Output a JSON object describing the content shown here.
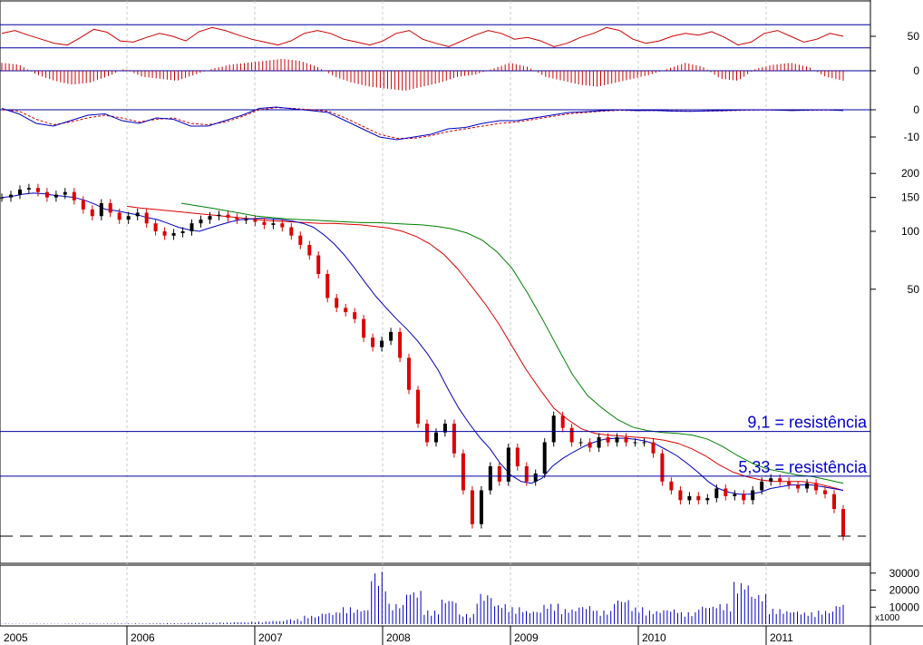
{
  "chart_data": {
    "type": "line",
    "scale": "log",
    "years": [
      "2005",
      "2006",
      "2007",
      "2008",
      "2009",
      "2010",
      "2011"
    ],
    "volume_unit": "x1000",
    "annotations": [
      {
        "text": "9,1 = resistência",
        "y": 9.1
      },
      {
        "text": "5,33 = resistência",
        "y": 5.33
      },
      {
        "text": "",
        "y": 2.6
      }
    ],
    "price_axis_ticks": [
      200,
      150,
      100,
      50
    ],
    "volume_axis_ticks": [
      30000,
      20000,
      10000
    ],
    "indicator1": {
      "ticks": [
        50
      ],
      "ref_lines": [
        70,
        30
      ],
      "ylim": [
        0,
        100
      ],
      "values": [
        55,
        60,
        52,
        45,
        38,
        35,
        48,
        62,
        57,
        42,
        40,
        48,
        55,
        50,
        42,
        58,
        65,
        60,
        52,
        45,
        40,
        35,
        42,
        55,
        60,
        55,
        45,
        40,
        35,
        42,
        55,
        60,
        45,
        38,
        32,
        42,
        52,
        60,
        55,
        45,
        48,
        42,
        32,
        38,
        48,
        55,
        65,
        60,
        45,
        38,
        42,
        50,
        55,
        52,
        58,
        48,
        35,
        40,
        55,
        60,
        50,
        40,
        45,
        55,
        50
      ]
    },
    "indicator2": {
      "ticks": [
        0
      ],
      "ylim": [
        -1,
        1
      ],
      "values": [
        0.4,
        0.3,
        -0.2,
        -0.5,
        -0.7,
        -0.6,
        -0.3,
        0.1,
        -0.3,
        -0.4,
        -0.5,
        -0.2,
        0.1,
        0.3,
        0.4,
        0.5,
        0.6,
        0.5,
        0.2,
        -0.3,
        -0.6,
        -0.8,
        -0.9,
        -1.0,
        -0.8,
        -0.6,
        -0.3,
        -0.2,
        0.1,
        0.4,
        0.2,
        -0.3,
        -0.5,
        -0.7,
        -0.8,
        -0.6,
        -0.4,
        -0.2,
        0.1,
        0.4,
        0.2,
        -0.4,
        -0.5,
        0.1,
        0.3,
        0.4,
        0.2,
        -0.3,
        -0.5
      ]
    },
    "indicator3": {
      "ticks": [
        0,
        -10
      ],
      "ylim": [
        -18,
        3
      ],
      "line": [
        0.5,
        -1.5,
        -5,
        -6,
        -4,
        -2,
        -1.5,
        -4,
        -5,
        -3,
        -3.5,
        -6,
        -6,
        -4,
        -2,
        0.5,
        1,
        0.3,
        -0.3,
        -1,
        -4,
        -7,
        -10,
        -11,
        -10,
        -9,
        -7,
        -6.5,
        -5,
        -4,
        -4,
        -3,
        -2,
        -1,
        -0.7,
        -0.3,
        0,
        -0.3,
        -0.2,
        -0.5,
        -0.6,
        -0.4,
        -0.3,
        -0.1,
        0,
        -0.1,
        -0.3,
        -0.1,
        0,
        -0.3
      ],
      "signal": [
        0,
        -0.5,
        -3.5,
        -5.5,
        -4.5,
        -3,
        -2,
        -3,
        -4.5,
        -3.5,
        -3,
        -5,
        -5.5,
        -4.5,
        -2.5,
        0,
        0.8,
        0.5,
        0,
        -0.5,
        -3,
        -6,
        -9,
        -10.5,
        -10.5,
        -9.5,
        -8,
        -7,
        -6,
        -5,
        -4.5,
        -3.5,
        -2.5,
        -1.5,
        -1,
        -0.5,
        -0.2,
        -0.3,
        -0.3,
        -0.4,
        -0.5,
        -0.5,
        -0.4,
        -0.2,
        -0.1,
        -0.1,
        -0.2,
        -0.2,
        -0.1,
        -0.2
      ]
    },
    "price": [
      150,
      155,
      165,
      168,
      160,
      150,
      155,
      160,
      145,
      130,
      120,
      140,
      125,
      115,
      120,
      125,
      110,
      100,
      95,
      98,
      100,
      110,
      115,
      120,
      122,
      118,
      115,
      115,
      112,
      108,
      110,
      105,
      95,
      85,
      75,
      60,
      45,
      40,
      38,
      35,
      28,
      25,
      27,
      30,
      22,
      15,
      10,
      8,
      9,
      10,
      7,
      4.5,
      3,
      4.5,
      6,
      5,
      7.5,
      6,
      5,
      5.5,
      8,
      11,
      9.5,
      8,
      8,
      7.5,
      8.5,
      8,
      8.5,
      8,
      8,
      8,
      7,
      5,
      4.5,
      4,
      4.2,
      4,
      4.1,
      4.6,
      4.2,
      4.3,
      4,
      4.5,
      5,
      5.2,
      5,
      4.8,
      4.6,
      4.9,
      4.5,
      4.3,
      3.6,
      2.6
    ],
    "ma_short": [
      150,
      152,
      156,
      158,
      157,
      154,
      152,
      150,
      145,
      138,
      130,
      128,
      125,
      122,
      118,
      115,
      110,
      105,
      102,
      100,
      104,
      108,
      112,
      115,
      116,
      117,
      116,
      115,
      113,
      110,
      105,
      96,
      86,
      75,
      64,
      54,
      46,
      40,
      35,
      31,
      27,
      23,
      19,
      15,
      12,
      10,
      8.5,
      7.4,
      6.2,
      5.4,
      5.0,
      4.9,
      5.2,
      6.0,
      6.6,
      7.1,
      7.6,
      8.0,
      8.3,
      8.4,
      8.4,
      8.3,
      8.1,
      7.8,
      7.3,
      6.8,
      6.2,
      5.6,
      5.0,
      4.6,
      4.4,
      4.3,
      4.3,
      4.4,
      4.6,
      4.7,
      4.8,
      4.8,
      4.8,
      4.7,
      4.6,
      4.5
    ],
    "ma_mid": [
      135,
      132,
      130,
      128,
      126,
      124,
      122,
      120,
      118,
      116,
      114,
      113,
      112,
      111,
      110,
      110,
      109,
      108,
      106,
      104,
      100,
      94,
      86,
      76,
      64,
      52,
      42,
      33,
      25,
      19,
      15,
      12,
      10.5,
      9.4,
      8.9,
      8.7,
      8.6,
      8.5,
      8.4,
      8.2,
      7.9,
      7.4,
      6.8,
      6.1,
      5.6,
      5.3,
      5.1,
      5.0,
      5.0,
      5.0,
      4.9,
      4.7,
      4.5
    ],
    "ma_long": [
      140,
      136,
      132,
      128,
      124,
      120,
      118,
      116,
      115,
      114,
      113,
      112,
      111,
      111,
      110,
      109,
      108,
      106,
      103,
      98,
      90,
      78,
      64,
      48,
      35,
      25,
      18,
      14,
      12,
      10.5,
      9.6,
      9.2,
      9.0,
      8.9,
      8.7,
      8.3,
      7.6,
      6.8,
      6.2,
      5.8,
      5.6,
      5.4,
      5.3,
      5.1,
      4.9
    ],
    "volume": [
      300,
      200,
      250,
      200,
      300,
      350,
      300,
      400,
      350,
      500,
      600,
      800,
      900,
      1000,
      1200,
      1500,
      2000,
      3000,
      5000,
      7000,
      10000,
      9000,
      31000,
      12000,
      20000,
      8000,
      15000,
      6000,
      18000,
      12000,
      10000,
      8000,
      12000,
      9000,
      11000,
      8000,
      15000,
      10000,
      8000,
      9000,
      7000,
      11000,
      12000,
      25000,
      18000,
      9000,
      8000,
      7000,
      8000,
      12000
    ]
  }
}
